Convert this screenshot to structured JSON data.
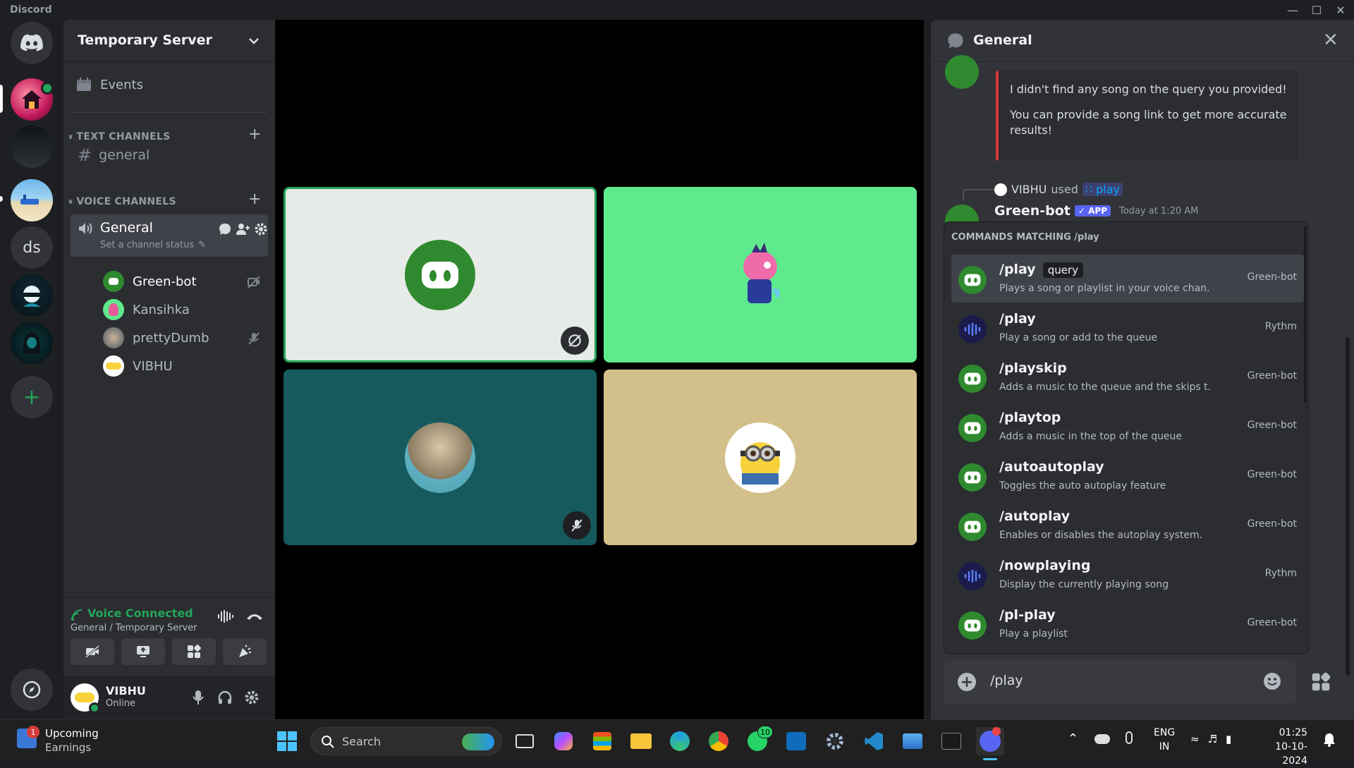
{
  "window": {
    "title": "Discord"
  },
  "rail": {
    "dm_icon": "discord-logo-icon",
    "servers": [
      "server-temp",
      "server-dark",
      "server-beach",
      "ds",
      "server-mask",
      "server-hood"
    ],
    "add_label": "+",
    "discover_icon": "compass-icon"
  },
  "server": {
    "name": "Temporary Server",
    "events": "Events"
  },
  "text_channels": {
    "header": "TEXT CHANNELS",
    "items": [
      "general"
    ]
  },
  "voice_channels": {
    "header": "VOICE CHANNELS",
    "channel": {
      "name": "General",
      "status": "Set a channel status"
    },
    "members": [
      "Green-bot",
      "Kansihka",
      "prettyDumb",
      "VIBHU"
    ]
  },
  "voice_status": {
    "title": "Voice Connected",
    "subtitle": "General / Temporary Server"
  },
  "user": {
    "name": "VIBHU",
    "status": "Online"
  },
  "chat": {
    "title": "General",
    "bot_msg": {
      "line1": "I didn't find any song on the query you provided!",
      "line2": "You can provide a song link to get more accurate results!"
    },
    "interaction": {
      "user": "VIBHU",
      "used": "used",
      "command": "play",
      "bot": "Green-bot",
      "tag": "✓ APP",
      "time": "Today at 1:20 AM"
    },
    "popup_header": "COMMANDS MATCHING /play",
    "commands": [
      {
        "name": "/play",
        "option": "query",
        "desc": "Plays a song or playlist in your voice chan...",
        "source": "Green-bot"
      },
      {
        "name": "/play",
        "option": "",
        "desc": "Play a song or add to the queue",
        "source": "Rythm"
      },
      {
        "name": "/playskip",
        "option": "",
        "desc": "Adds a music to the queue and the skips t...",
        "source": "Green-bot"
      },
      {
        "name": "/playtop",
        "option": "",
        "desc": "Adds a music in the top of the queue",
        "source": "Green-bot"
      },
      {
        "name": "/autoautoplay",
        "option": "",
        "desc": "Toggles the auto autoplay feature",
        "source": "Green-bot"
      },
      {
        "name": "/autoplay",
        "option": "",
        "desc": "Enables or disables the autoplay system.",
        "source": "Green-bot"
      },
      {
        "name": "/nowplaying",
        "option": "",
        "desc": "Display the currently playing song",
        "source": "Rythm"
      },
      {
        "name": "/pl-play",
        "option": "",
        "desc": "Play a playlist",
        "source": "Green-bot"
      }
    ],
    "input_value": "/play"
  },
  "taskbar": {
    "widget_title": "Upcoming",
    "widget_sub": "Earnings",
    "widget_badge": "1",
    "search_label": "Search",
    "whatsapp_badge": "10",
    "lang1": "ENG",
    "lang2": "IN",
    "time": "01:25",
    "date": "10-10-2024"
  },
  "colors": {
    "green_bot": "#2f8a2f",
    "tile_green": "#5fea8d",
    "tile_teal": "#165a5e",
    "tile_tan": "#d3bf8a",
    "accent": "#5865f2",
    "online": "#23a55a"
  }
}
